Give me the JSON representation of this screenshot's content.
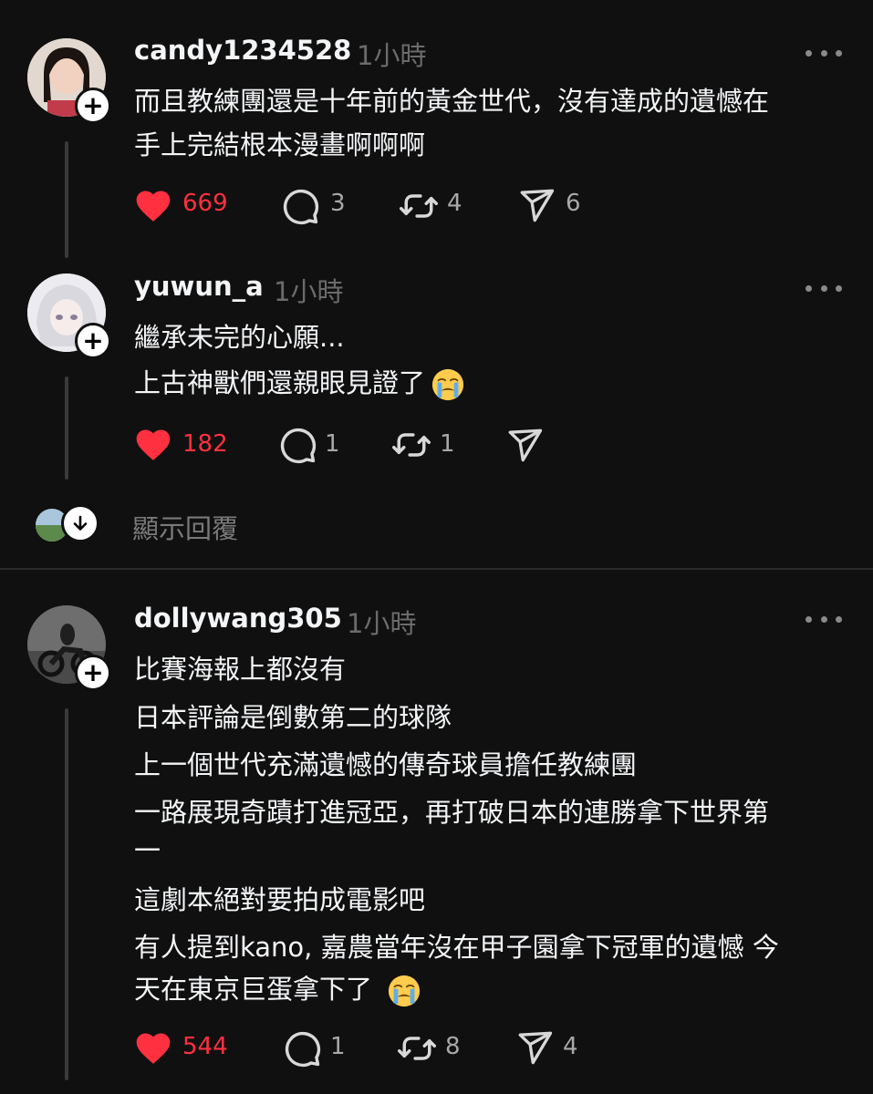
{
  "comments": [
    {
      "username": "candy1234528",
      "time": "1小時",
      "lines": [
        "而且教練團還是十年前的黃金世代，沒有達成的遺憾在",
        "手上完結根本漫畫啊啊啊"
      ],
      "likes": "669",
      "replies": "3",
      "reposts": "4",
      "shares": "6"
    },
    {
      "username": "yuwun_a",
      "time": "1小時",
      "lines": [
        "繼承未完的心願...",
        "上古神獸們還親眼見證了"
      ],
      "likes": "182",
      "replies": "1",
      "reposts": "1",
      "shares": ""
    },
    {
      "username": "dollywang305",
      "time": "1小時",
      "lines": [
        "比賽海報上都沒有",
        "日本評論是倒數第二的球隊",
        "上一個世代充滿遺憾的傳奇球員擔任教練團",
        "一路展現奇蹟打進冠亞，再打破日本的連勝拿下世界第",
        "一",
        "這劇本絕對要拍成電影吧",
        "有人提到kano, 嘉農當年沒在甲子園拿下冠軍的遺憾 今",
        "天在東京巨蛋拿下了"
      ],
      "likes": "544",
      "replies": "1",
      "reposts": "8",
      "shares": "4"
    }
  ],
  "show_replies": "顯示回覆",
  "icons": {
    "like": "heart-icon",
    "reply": "speech-bubble-icon",
    "repost": "repost-icon",
    "share": "send-icon",
    "follow": "plus-icon",
    "more": "more-dots-icon",
    "expand": "arrow-down-icon",
    "emoji": "loudly-crying-face-emoji"
  },
  "colors": {
    "background": "#101010",
    "liked": "#ff3040",
    "text": "#f3f5f7",
    "muted": "#6b6b6b"
  }
}
